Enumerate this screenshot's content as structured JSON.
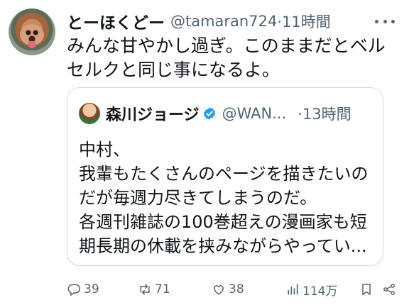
{
  "tweet": {
    "display_name": "とーほくどー",
    "handle": "@tamaran724",
    "time": "·11時間",
    "text_lines": [
      "みんな甘やかし過ぎ。このままだとベル",
      "セルクと同じ事になるよ。"
    ]
  },
  "quote": {
    "display_name": "森川ジョージ",
    "handle": "@WAN...",
    "time": "·13時間",
    "text_lines": [
      "中村、",
      "我輩もたくさんのページを描きたいの",
      "だが毎週力尽きてしまうのだ。",
      "各週刊雑誌の100巻超えの漫画家も短",
      "期長期の休載を挟みながらやってい..."
    ]
  },
  "actions": {
    "replies": "39",
    "retweets": "71",
    "likes": "38",
    "views": "114万"
  },
  "colors": {
    "text": "#0f1419",
    "secondary": "#536471",
    "border": "#cfd9de",
    "verified": "#1d9bf0"
  }
}
